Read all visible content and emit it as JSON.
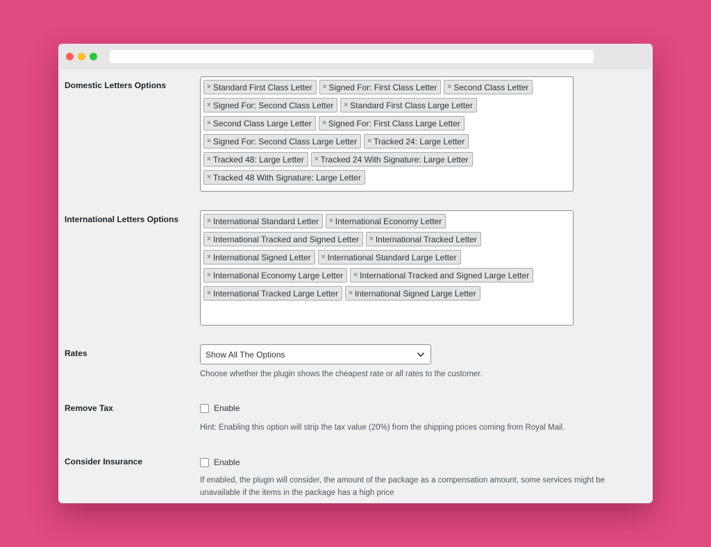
{
  "browser": {
    "url": ""
  },
  "domestic": {
    "label": "Domestic Letters Options",
    "tags": [
      "Standard First Class Letter",
      "Signed For: First Class Letter",
      "Second Class Letter",
      "Signed For: Second Class Letter",
      "Standard First Class Large Letter",
      "Second Class Large Letter",
      "Signed For: First Class Large Letter",
      "Signed For: Second Class Large Letter",
      "Tracked 24: Large Letter",
      "Tracked 48: Large Letter",
      "Tracked 24 With Signature: Large Letter",
      "Tracked 48 With Signature: Large Letter"
    ]
  },
  "international": {
    "label": "International Letters Options",
    "tags": [
      "International Standard Letter",
      "International Economy Letter",
      "International Tracked and Signed Letter",
      "International Tracked Letter",
      "International Signed Letter",
      "International Standard Large Letter",
      "International Economy Large Letter",
      "International Tracked and Signed Large Letter",
      "International Tracked Large Letter",
      "International Signed Large Letter"
    ]
  },
  "rates": {
    "label": "Rates",
    "selected": "Show All The Options",
    "description": "Choose whether the plugin shows the cheapest rate or all rates to the customer."
  },
  "remove_tax": {
    "label": "Remove Tax",
    "checkbox_label": "Enable",
    "checked": false,
    "hint": "Hint: Enabling this option will strip the tax value (20%) from the shipping prices coming from Royal Mail."
  },
  "insurance": {
    "label": "Consider Insurance",
    "checkbox_label": "Enable",
    "checked": false,
    "description": "If enabled, the plugin will consider, the amount of the package as a compensation amount, some services might be unavailable if the items in the package has a high price"
  },
  "icons": {
    "tag_remove": "close-icon",
    "select_arrow": "chevron-down-icon"
  }
}
